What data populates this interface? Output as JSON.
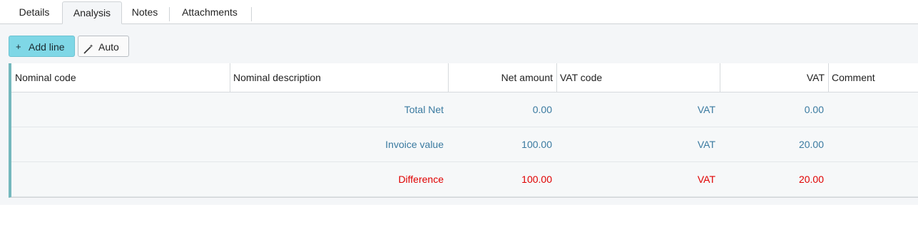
{
  "tabs": [
    {
      "label": "Details"
    },
    {
      "label": "Analysis"
    },
    {
      "label": "Notes"
    },
    {
      "label": "Attachments"
    }
  ],
  "toolbar": {
    "add_line_label": "Add line",
    "add_line_icon": "+",
    "auto_label": "Auto",
    "auto_icon": "magic-wand-icon"
  },
  "table": {
    "columns": [
      "Nominal code",
      "Nominal description",
      "Net amount",
      "VAT code",
      "VAT",
      "Comment"
    ],
    "rows": [
      {
        "label": "Total Net",
        "net": "0.00",
        "vat_code": "VAT",
        "vat": "0.00",
        "color": "#3a7aa0"
      },
      {
        "label": "Invoice value",
        "net": "100.00",
        "vat_code": "VAT",
        "vat": "20.00",
        "color": "#3a7aa0"
      },
      {
        "label": "Difference",
        "net": "100.00",
        "vat_code": "VAT",
        "vat": "20.00",
        "color": "#e00000"
      }
    ]
  },
  "colors": {
    "accent": "#7fd7e6",
    "summary_text": "#3a7aa0",
    "difference_text": "#e00000",
    "row_marker": "#74b8bd"
  }
}
